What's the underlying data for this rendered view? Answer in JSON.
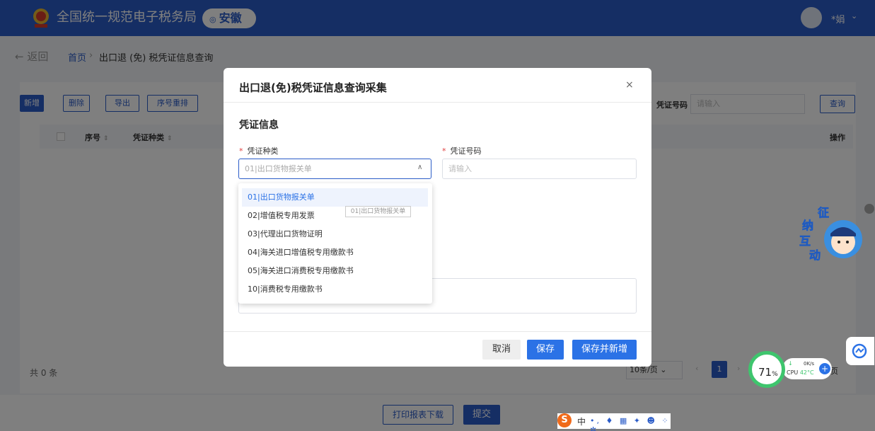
{
  "header": {
    "site_title": "全国统一规范电子税务局",
    "region": "安徽",
    "user_name": "*娟",
    "user_chevron": "⌄"
  },
  "breadcrumb": {
    "back": "← 返回",
    "home": "首页",
    "separator": "›",
    "current": "出口退 (免) 税凭证信息查询"
  },
  "toolbar": {
    "add": "新增",
    "delete": "删除",
    "export": "导出",
    "reorder": "序号重排",
    "search_label": "凭证号码",
    "search_placeholder": "请输入",
    "search_button": "查询"
  },
  "table": {
    "columns": [
      "序号",
      "凭证种类",
      "操作"
    ]
  },
  "pagination": {
    "total": "共 0 条",
    "page_size": "10条/页",
    "current_page": "1",
    "suffix": "页"
  },
  "footer": {
    "print": "打印报表下载",
    "submit": "提交"
  },
  "modal": {
    "title": "出口退(免)税凭证信息查询采集",
    "close": "×",
    "section": "凭证信息",
    "voucher_type_label": "凭证种类",
    "voucher_type_placeholder": "01|出口货物报关单",
    "voucher_no_label": "凭证号码",
    "voucher_no_placeholder": "请输入",
    "cancel": "取消",
    "save": "保存",
    "save_new": "保存并新增"
  },
  "dropdown": {
    "options": [
      "01|出口货物报关单",
      "02|增值税专用发票",
      "03|代理出口货物证明",
      "04|海关进口增值税专用缴款书",
      "05|海关进口消费税专用缴款书",
      "10|消费税专用缴款书"
    ],
    "tooltip": "01|出口货物报关单"
  },
  "mascot": {
    "chars": [
      "征",
      "纳",
      "互",
      "动"
    ]
  },
  "system": {
    "cpu_percent": "71",
    "cpu_percent_unit": "%",
    "net_speed": "0K/s",
    "cpu_label": "CPU",
    "cpu_temp": "42°C"
  },
  "ime": {
    "logo": "S",
    "mode": "中",
    "tools": "•, ♦ ▦ ✦ ☻ ⁘ ✲"
  },
  "colors": {
    "brand_blue": "#2b5cc8",
    "button_blue": "#2b72e6",
    "required_red": "#e04040",
    "cpu_green": "#3ec56d"
  }
}
